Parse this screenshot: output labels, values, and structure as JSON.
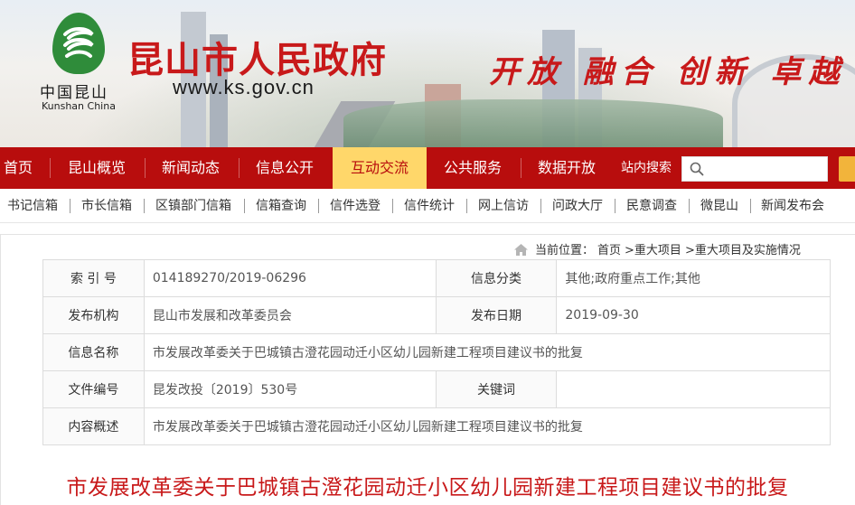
{
  "header": {
    "logo_cn": "中国昆山",
    "logo_en": "Kunshan China",
    "site_title": "昆山市人民政府",
    "site_url": "www.ks.gov.cn",
    "slogan": "开放 融合 创新 卓越"
  },
  "mainnav": {
    "items": [
      "首页",
      "昆山概览",
      "新闻动态",
      "信息公开",
      "互动交流",
      "公共服务",
      "数据开放"
    ],
    "active": "互动交流",
    "search_label": "站内搜索",
    "search_placeholder": ""
  },
  "subnav": {
    "items": [
      "书记信箱",
      "市长信箱",
      "区镇部门信箱",
      "信箱查询",
      "信件选登",
      "信件统计",
      "网上信访",
      "问政大厅",
      "民意调查",
      "微昆山",
      "新闻发布会"
    ]
  },
  "breadcrumb": {
    "prefix": "当前位置：",
    "items": [
      "首页",
      ">重大项目",
      ">重大项目及实施情况"
    ]
  },
  "info_table": {
    "index_label": "索 引 号",
    "index_value": "014189270/2019-06296",
    "category_label": "信息分类",
    "category_value": "其他;政府重点工作;其他",
    "publisher_label": "发布机构",
    "publisher_value": "昆山市发展和改革委员会",
    "date_label": "发布日期",
    "date_value": "2019-09-30",
    "name_label": "信息名称",
    "name_value": "市发展改革委关于巴城镇古澄花园动迁小区幼儿园新建工程项目建议书的批复",
    "docno_label": "文件编号",
    "docno_value": "昆发改投〔2019〕530号",
    "keywords_label": "关键词",
    "keywords_value": "",
    "summary_label": "内容概述",
    "summary_value": "市发展改革委关于巴城镇古澄花园动迁小区幼儿园新建工程项目建议书的批复"
  },
  "document": {
    "title": "市发展改革委关于巴城镇古澄花园动迁小区幼儿园新建工程项目建议书的批复"
  },
  "colors": {
    "brand_red": "#c8191a",
    "nav_red": "#b80d0d",
    "nav_active": "#ffd76a",
    "emblem_green": "#2f8c3a"
  }
}
